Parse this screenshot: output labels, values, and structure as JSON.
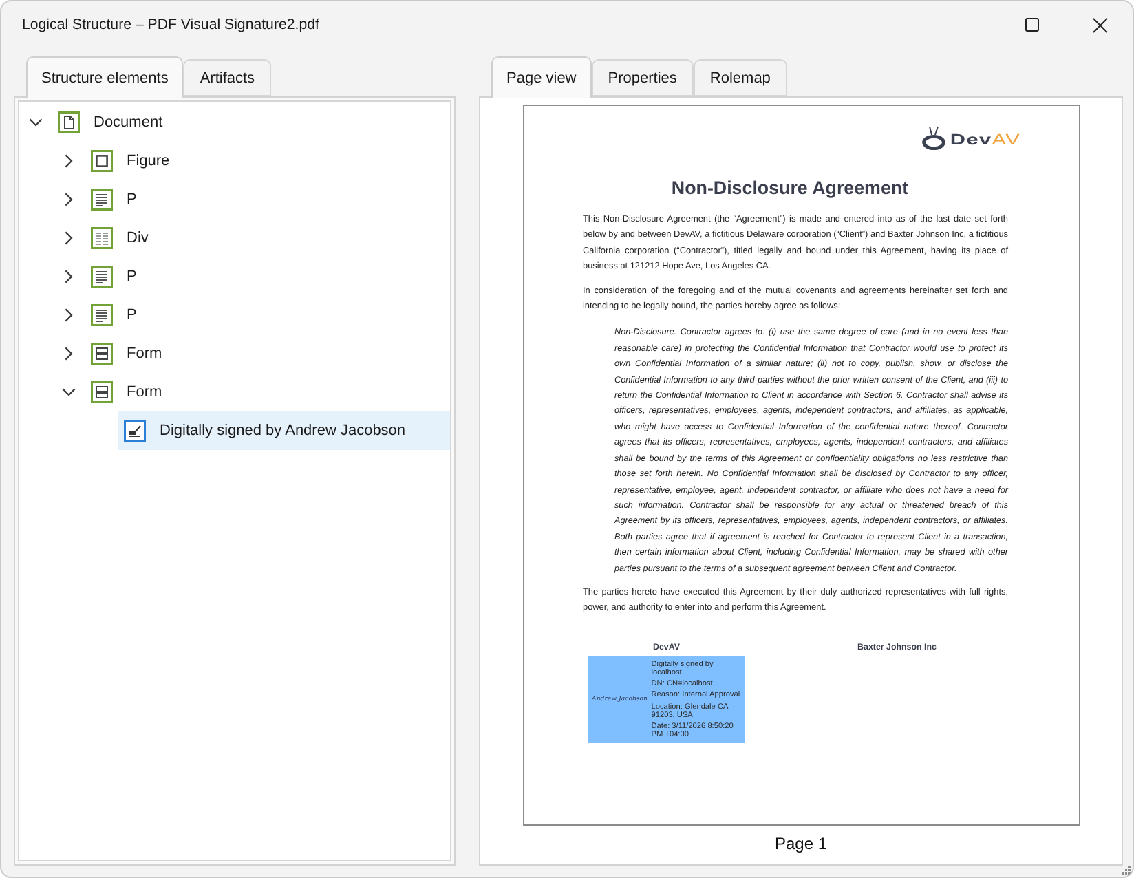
{
  "window": {
    "title": "Logical Structure – PDF Visual Signature2.pdf"
  },
  "left_tabs": [
    {
      "label": "Structure elements",
      "selected": true
    },
    {
      "label": "Artifacts",
      "selected": false
    }
  ],
  "tree": [
    {
      "label": "Document",
      "kind": "document",
      "expanded": true,
      "selected": false,
      "children": [
        {
          "label": "Figure",
          "kind": "figure",
          "expanded": false,
          "selected": false
        },
        {
          "label": "P",
          "kind": "paragraph",
          "expanded": false,
          "selected": false
        },
        {
          "label": "Div",
          "kind": "div",
          "expanded": false,
          "selected": false
        },
        {
          "label": "P",
          "kind": "paragraph",
          "expanded": false,
          "selected": false
        },
        {
          "label": "P",
          "kind": "paragraph",
          "expanded": false,
          "selected": false
        },
        {
          "label": "Form",
          "kind": "form",
          "expanded": false,
          "selected": false
        },
        {
          "label": "Form",
          "kind": "form",
          "expanded": true,
          "selected": false,
          "children": [
            {
              "label": "Digitally signed by Andrew Jacobson",
              "kind": "signature",
              "selected": true
            }
          ]
        }
      ]
    }
  ],
  "right_tabs": [
    {
      "label": "Page view",
      "selected": true
    },
    {
      "label": "Properties",
      "selected": false
    },
    {
      "label": "Rolemap",
      "selected": false
    }
  ],
  "page_view": {
    "document": {
      "logo": {
        "name": "Dev",
        "accent": "AV"
      },
      "title": "Non-Disclosure Agreement",
      "paragraphs": [
        {
          "kind": "body",
          "text": "This Non-Disclosure Agreement (the “Agreement”) is made and entered into as of the last date set forth below by and between DevAV, a fictitious Delaware corporation (“Client”) and Baxter Johnson Inc, a fictitious California corporation (“Contractor”), titled legally and bound under this Agreement, having its place of business at 121212 Hope Ave, Los Angeles CA."
        },
        {
          "kind": "body",
          "text": "In consideration of the foregoing and of the mutual covenants and agreements hereinafter set forth and intending to be legally bound, the parties hereby agree as follows:"
        },
        {
          "kind": "indented",
          "text": "Non-Disclosure. Contractor agrees to: (i) use the same degree of care (and in no event less than reasonable care) in protecting the Confidential Information that Contractor would use to protect its own Confidential Information of a similar nature; (ii) not to copy, publish, show, or disclose the Confidential Information to any third parties without the prior written consent of the Client, and (iii) to return the Confidential Information to Client in accordance with Section 6. Contractor shall advise its officers, representatives, employees, agents, independent contractors, and affiliates, as applicable, who might have access to Confidential Information of the confidential nature thereof. Contractor agrees that its officers, representatives, employees, agents, independent contractors, and affiliates shall be bound by the terms of this Agreement or confidentiality obligations no less restrictive than those set forth herein. No Confidential Information shall be disclosed by Contractor to any officer, representative, employee, agent, independent contractor, or affiliate who does not have a need for such information. Contractor shall be responsible for any actual or threatened breach of this Agreement by its officers, representatives, employees, agents, independent contractors, or affiliates. Both parties agree that if agreement is reached for Contractor to represent Client in a transaction, then certain information about Client, including Confidential Information, may be shared with other parties pursuant to the terms of a subsequent agreement between Client and Contractor."
        },
        {
          "kind": "body",
          "text": "The parties hereto have executed this Agreement by their duly authorized representatives with full rights, power, and authority to enter into and perform this Agreement."
        }
      ],
      "signatories": [
        {
          "name": "DevAV",
          "stamp": {
            "handwriting": "Andrew Jacobson",
            "details": [
              "Digitally signed by localhost",
              "DN: CN=localhost",
              "Reason: Internal Approval",
              "Location: Glendale CA 91203, USA",
              "Date: 3/11/2026 8:50:20 PM +04:00"
            ]
          }
        },
        {
          "name": "Baxter Johnson Inc"
        }
      ]
    },
    "page_label": "Page 1"
  }
}
